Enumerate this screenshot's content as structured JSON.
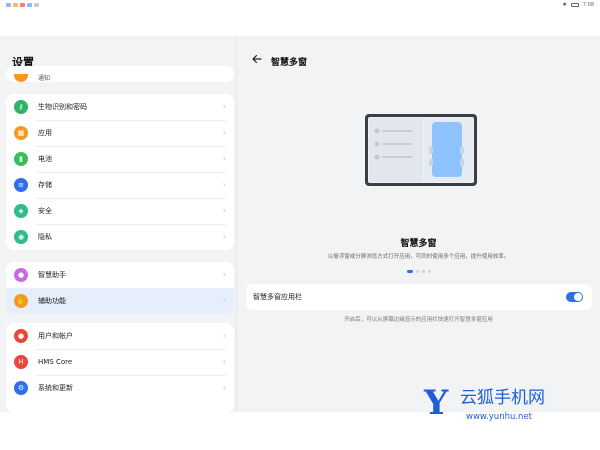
{
  "status": {
    "time": "7:08"
  },
  "left": {
    "title": "设置",
    "top_partial_label": "通知",
    "groups": [
      [
        {
          "label": "生物识别和密码",
          "icon": "key-icon",
          "color": "#2fb26b"
        },
        {
          "label": "应用",
          "icon": "apps-grid-icon",
          "color": "#f29a1f"
        },
        {
          "label": "电池",
          "icon": "battery-icon",
          "color": "#34c15a"
        },
        {
          "label": "存储",
          "icon": "storage-icon",
          "color": "#2f6fed"
        },
        {
          "label": "安全",
          "icon": "shield-icon",
          "color": "#2dbb8a"
        },
        {
          "label": "隐私",
          "icon": "privacy-icon",
          "color": "#2dbb8a"
        }
      ],
      [
        {
          "label": "智慧助手",
          "icon": "assistant-orb-icon",
          "color": "#c46de0"
        },
        {
          "label": "辅助功能",
          "icon": "hand-icon",
          "color": "#f29a1f",
          "active": true
        }
      ],
      [
        {
          "label": "用户和帐户",
          "icon": "user-icon",
          "color": "#e8473c"
        },
        {
          "label": "HMS Core",
          "icon": "hms-core-icon",
          "color": "#e8473c"
        },
        {
          "label": "系统和更新",
          "icon": "system-update-icon",
          "color": "#2f6fed"
        }
      ]
    ]
  },
  "right": {
    "title": "智慧多窗",
    "feature_title": "智慧多窗",
    "feature_desc": "以悬浮窗或分屏浏览方式打开应用，可同时使用多个应用，提升使用效率。",
    "toggle_label": "智慧多窗应用栏",
    "toggle_on": true,
    "toggle_hint": "开启后，可以从屏幕边缘显示的应用栏快速打开智慧多窗应用",
    "carousel": {
      "count": 4,
      "active": 0
    }
  },
  "watermark": {
    "letter": "Y",
    "text": "云狐手机网",
    "url": "www.yunhu.net"
  },
  "colors": {
    "accent": "#2f6fed",
    "background": "#f1f3f5"
  }
}
